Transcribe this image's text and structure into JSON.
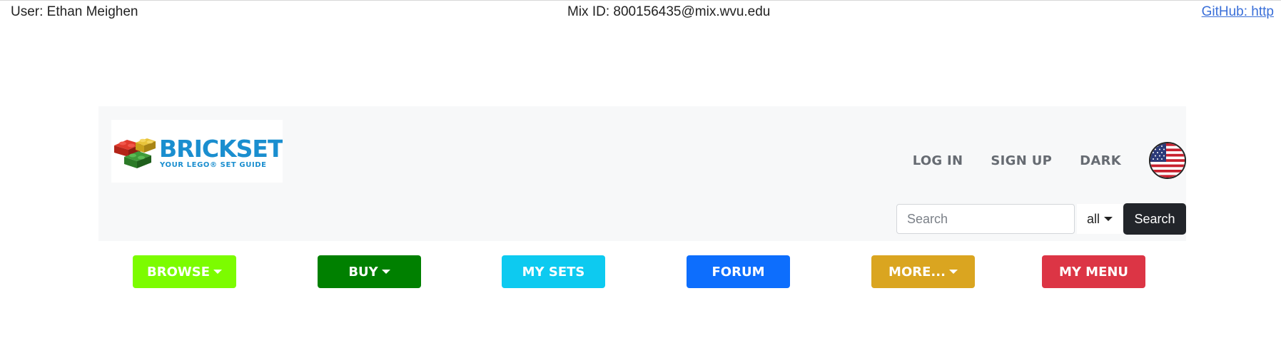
{
  "topbar": {
    "user": "User: Ethan Meighen",
    "mix_id": "Mix ID: 800156435@mix.wvu.edu",
    "github": "GitHub: http"
  },
  "logo": {
    "brand": "BRICKSET",
    "tagline": "YOUR LEGO® SET GUIDE"
  },
  "nav": {
    "login": "LOG IN",
    "signup": "SIGN UP",
    "dark": "DARK",
    "flag_icon": "us-flag-icon"
  },
  "search": {
    "placeholder": "Search",
    "value": "",
    "scope": "all",
    "button": "Search"
  },
  "menu": {
    "browse": {
      "label": "BROWSE",
      "color": "#7cfc00"
    },
    "buy": {
      "label": "BUY",
      "color": "#008000"
    },
    "my_sets": {
      "label": "MY SETS",
      "color": "#0dcaf0"
    },
    "forum": {
      "label": "FORUM",
      "color": "#0d6efd"
    },
    "more": {
      "label": "MORE...",
      "color": "#daa520"
    },
    "my_menu": {
      "label": "MY MENU",
      "color": "#dc3545"
    }
  }
}
